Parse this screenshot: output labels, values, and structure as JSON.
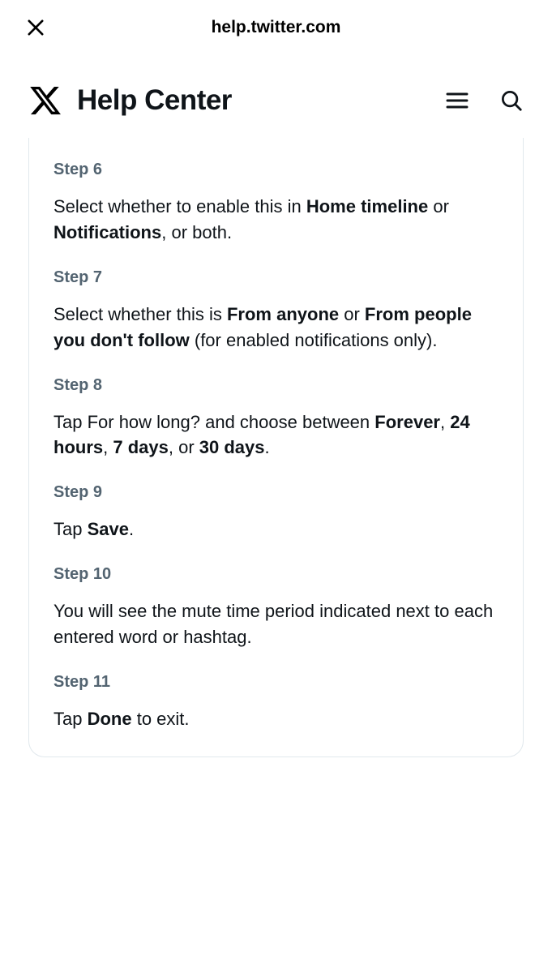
{
  "browser": {
    "url": "help.twitter.com"
  },
  "header": {
    "title": "Help Center"
  },
  "steps": [
    {
      "label": "Step 6",
      "segments": [
        {
          "t": "Select whether to enable this in ",
          "b": false
        },
        {
          "t": "Home timeline",
          "b": true
        },
        {
          "t": " or ",
          "b": false
        },
        {
          "t": "Notifications",
          "b": true
        },
        {
          "t": ", or both.",
          "b": false
        }
      ]
    },
    {
      "label": "Step 7",
      "segments": [
        {
          "t": "Select whether this is ",
          "b": false
        },
        {
          "t": "From anyone",
          "b": true
        },
        {
          "t": " or ",
          "b": false
        },
        {
          "t": "From people you don't follow",
          "b": true
        },
        {
          "t": " (for enabled notifications only).",
          "b": false
        }
      ]
    },
    {
      "label": "Step 8",
      "segments": [
        {
          "t": "Tap For how long? and choose between ",
          "b": false
        },
        {
          "t": "Forever",
          "b": true
        },
        {
          "t": ", ",
          "b": false
        },
        {
          "t": "24 hours",
          "b": true
        },
        {
          "t": ", ",
          "b": false
        },
        {
          "t": "7 days",
          "b": true
        },
        {
          "t": ", or ",
          "b": false
        },
        {
          "t": "30 days",
          "b": true
        },
        {
          "t": ".",
          "b": false
        }
      ]
    },
    {
      "label": "Step 9",
      "segments": [
        {
          "t": "Tap ",
          "b": false
        },
        {
          "t": "Save",
          "b": true
        },
        {
          "t": ".",
          "b": false
        }
      ]
    },
    {
      "label": "Step 10",
      "segments": [
        {
          "t": "You will see the mute time period indicated next to each entered word or hashtag.",
          "b": false
        }
      ]
    },
    {
      "label": "Step 11",
      "segments": [
        {
          "t": "Tap ",
          "b": false
        },
        {
          "t": "Done",
          "b": true
        },
        {
          "t": " to exit.",
          "b": false
        }
      ]
    }
  ]
}
